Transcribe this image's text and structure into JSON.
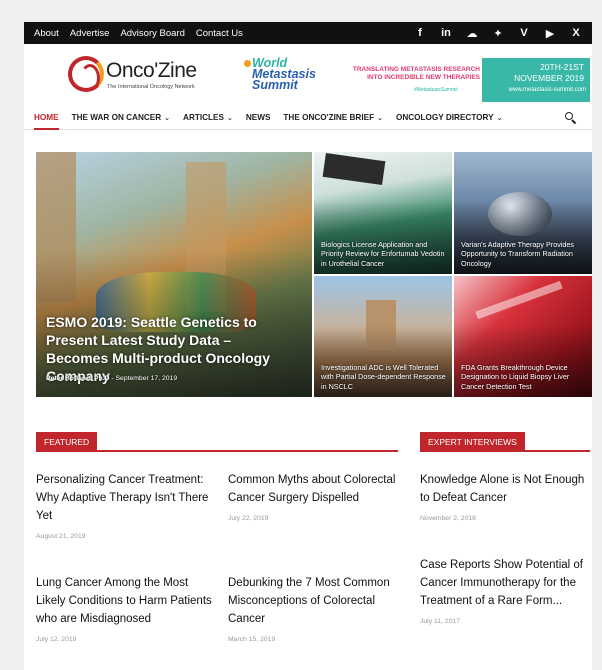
{
  "topbar": {
    "links": [
      "About",
      "Advertise",
      "Advisory Board",
      "Contact Us"
    ],
    "social": [
      {
        "icon": "facebook-icon",
        "glyph": "f"
      },
      {
        "icon": "linkedin-icon",
        "glyph": "in"
      },
      {
        "icon": "soundcloud-icon",
        "glyph": "☁"
      },
      {
        "icon": "twitter-icon",
        "glyph": "✦"
      },
      {
        "icon": "vimeo-icon",
        "glyph": "V"
      },
      {
        "icon": "youtube-icon",
        "glyph": "▶"
      },
      {
        "icon": "xing-icon",
        "glyph": "X"
      }
    ]
  },
  "logo": {
    "name": "Onco'Zine",
    "tagline": "The International Oncology Network"
  },
  "banner": {
    "event_line1": "World",
    "event_line2": "Metastasis",
    "event_line3": "Summit",
    "tagline_line1": "TRANSLATING METASTASIS RESEARCH",
    "tagline_line2": "INTO INCREDIBLE NEW THERAPIES",
    "hashtag": "#MetastasisSummit",
    "date_line1": "20TH-21ST",
    "date_line2": "NOVEMBER 2019",
    "url": "www.metastasis-summit.com",
    "accent_color": "#39b8a8"
  },
  "nav": {
    "items": [
      {
        "label": "HOME",
        "dropdown": false,
        "active": true
      },
      {
        "label": "THE WAR ON CANCER",
        "dropdown": true,
        "active": false
      },
      {
        "label": "ARTICLES",
        "dropdown": true,
        "active": false
      },
      {
        "label": "NEWS",
        "dropdown": false,
        "active": false
      },
      {
        "label": "THE ONCO'ZINE BRIEF",
        "dropdown": true,
        "active": false
      },
      {
        "label": "ONCOLOGY DIRECTORY",
        "dropdown": true,
        "active": false
      }
    ],
    "search_icon": "search-icon"
  },
  "featured_grid": {
    "main": {
      "title": "ESMO 2019: Seattle Genetics to Present Latest Study Data – Becomes Multi-product Oncology Company",
      "author": "Peter Hofland, Ph.D",
      "date": "September 17, 2019"
    },
    "tiles": [
      {
        "title": "Biologics License Application and Priority Review for Enfortumab Vedotin in Urothelial Cancer"
      },
      {
        "title": "Varian's Adaptive Therapy Provides Opportunity to Transform Radiation Oncology"
      },
      {
        "title": "Investigational ADC is Well Tolerated with Partial Dose-dependent Response in NSCLC"
      },
      {
        "title": "FDA Grants Breakthrough Device Designation to Liquid Biopsy Liver Cancer Detection Test"
      }
    ]
  },
  "featured": {
    "label": "FEATURED",
    "articles": [
      {
        "title": "Personalizing Cancer Treatment: Why Adaptive Therapy Isn't There Yet",
        "date": "August 21, 2019"
      },
      {
        "title": "Common Myths about Colorectal Cancer Surgery Dispelled",
        "date": "July 22, 2019"
      },
      {
        "title": "Lung Cancer Among the Most Likely Conditions to Harm Patients who are Misdiagnosed",
        "date": "July 12, 2019"
      },
      {
        "title": "Debunking the 7 Most Common Misconceptions of Colorectal Cancer",
        "date": "March 15, 2019"
      }
    ]
  },
  "expert": {
    "label": "EXPERT INTERVIEWS",
    "articles": [
      {
        "title": "Knowledge Alone is Not Enough to Defeat Cancer",
        "date": "November 2, 2018"
      },
      {
        "title": "Case Reports Show Potential of Cancer Immunotherapy for the Treatment of a Rare Form...",
        "date": "July 11, 2017"
      }
    ]
  },
  "colors": {
    "brand_red": "#c0262c",
    "topbar": "#111111",
    "logo_orange": "#f29c1f"
  }
}
